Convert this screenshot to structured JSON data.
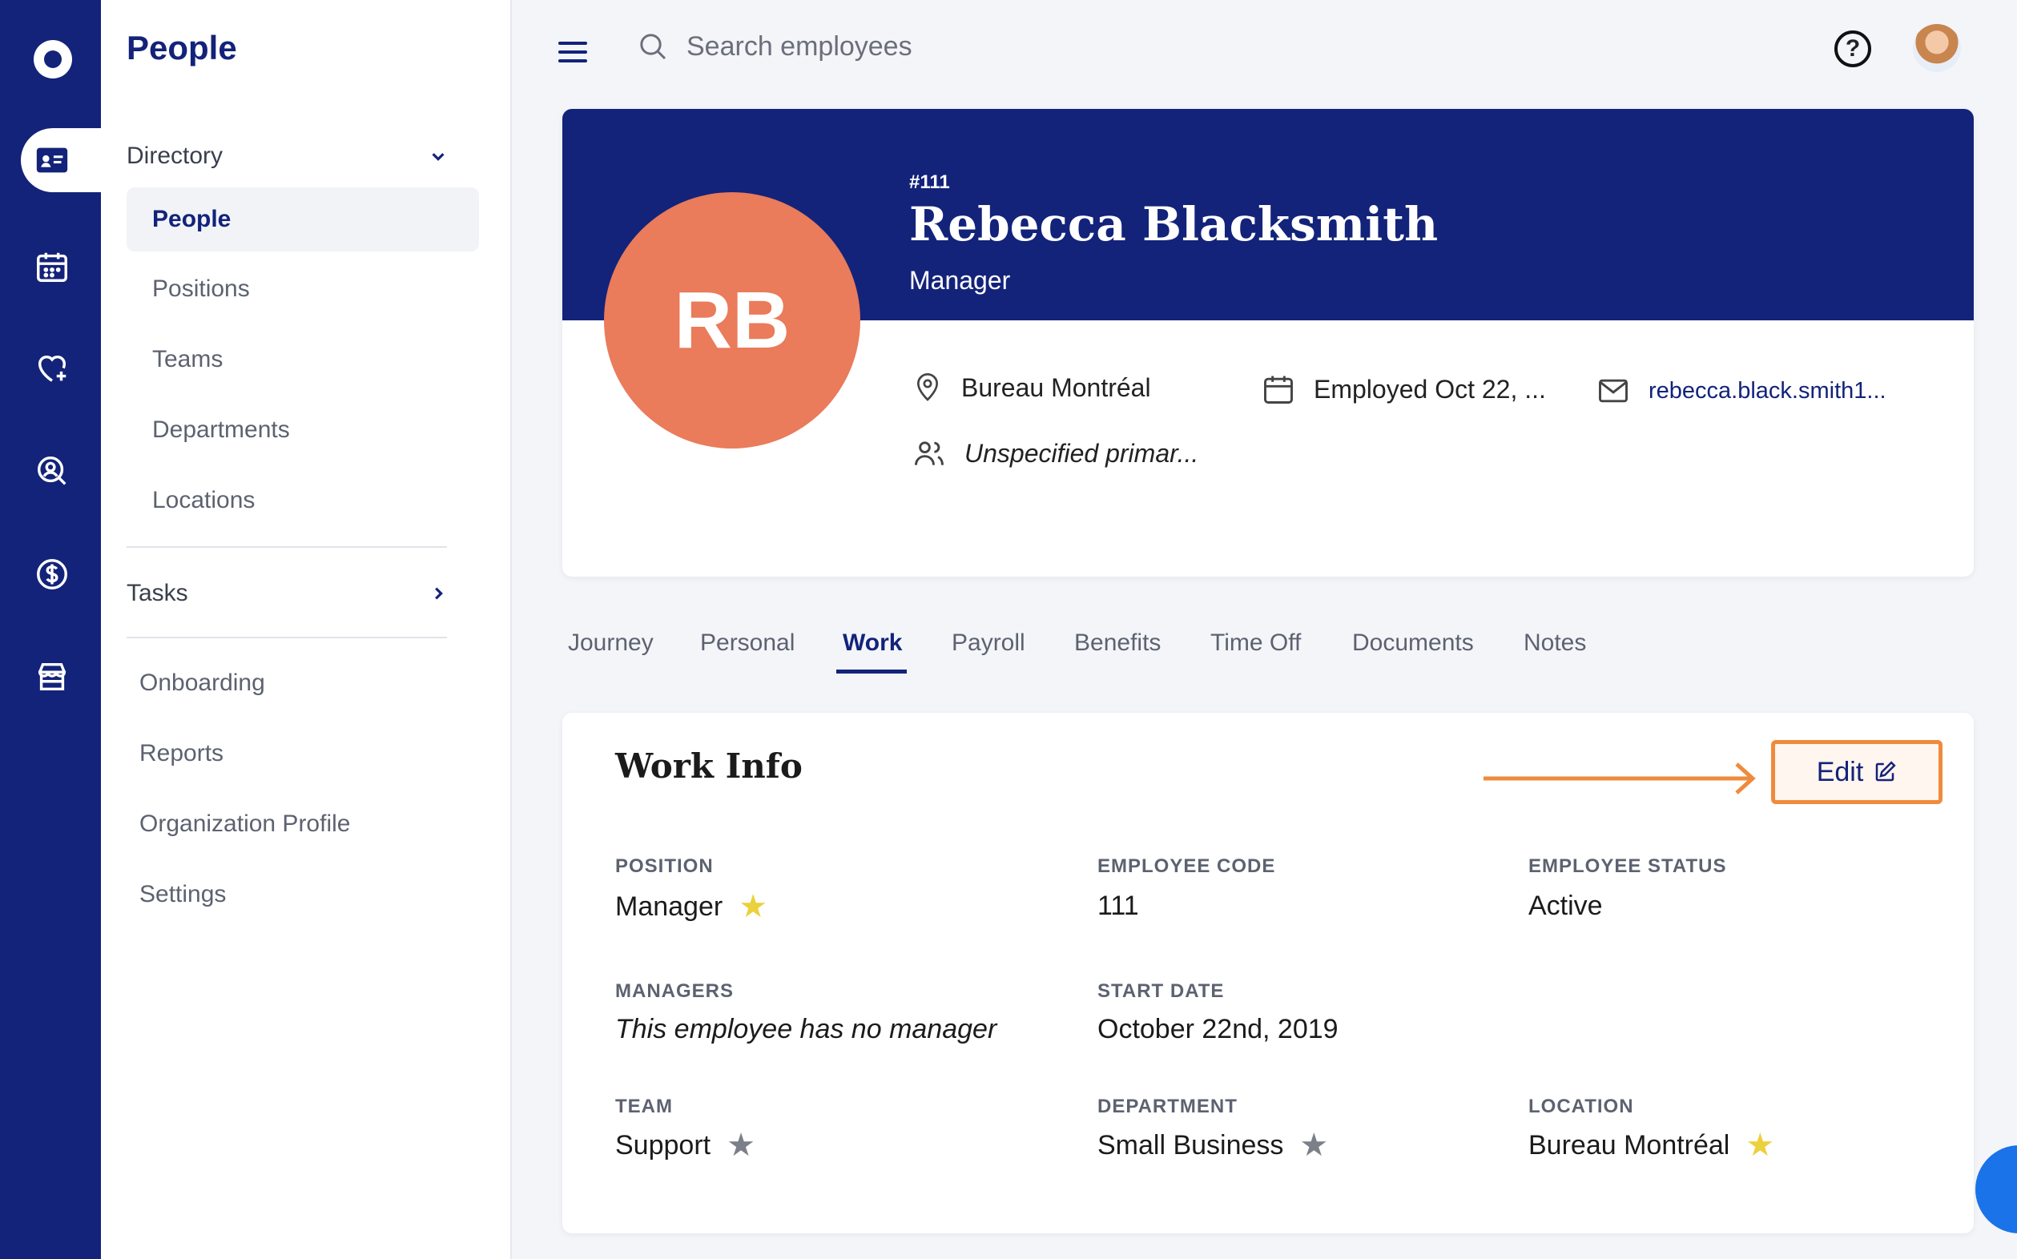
{
  "app": {
    "section_title": "People"
  },
  "rail": {
    "icons": [
      "logo-icon",
      "directory-icon",
      "calendar-icon",
      "heart-plus-icon",
      "people-search-icon",
      "dollar-icon",
      "store-icon"
    ]
  },
  "sidebar": {
    "directory": {
      "label": "Directory",
      "items": [
        "People",
        "Positions",
        "Teams",
        "Departments",
        "Locations"
      ],
      "active": "People"
    },
    "tasks": {
      "label": "Tasks"
    },
    "other_items": [
      "Onboarding",
      "Reports",
      "Organization Profile",
      "Settings"
    ]
  },
  "topbar": {
    "search_placeholder": "Search employees",
    "help_glyph": "?"
  },
  "profile": {
    "code": "#111",
    "name": "Rebecca Blacksmith",
    "title": "Manager",
    "initials": "RB",
    "location": "Bureau Montréal",
    "employed": "Employed Oct 22, ...",
    "email": "rebecca.black.smith1...",
    "team": "Unspecified primar...",
    "avatar_color": "#ea7b5b",
    "banner_color": "#13237a"
  },
  "tabs": [
    "Journey",
    "Personal",
    "Work",
    "Payroll",
    "Benefits",
    "Time Off",
    "Documents",
    "Notes"
  ],
  "active_tab": "Work",
  "work_info": {
    "title": "Work Info",
    "edit_label": "Edit",
    "fields": {
      "position": {
        "label": "POSITION",
        "value": "Manager",
        "star": "gold"
      },
      "employee_code": {
        "label": "EMPLOYEE CODE",
        "value": "111"
      },
      "employee_status": {
        "label": "EMPLOYEE STATUS",
        "value": "Active"
      },
      "managers": {
        "label": "MANAGERS",
        "value": "This employee has no manager"
      },
      "start_date": {
        "label": "START DATE",
        "value": "October 22nd, 2019"
      },
      "team": {
        "label": "TEAM",
        "value": "Support",
        "star": "grey"
      },
      "department": {
        "label": "DEPARTMENT",
        "value": "Small Business",
        "star": "grey"
      },
      "location": {
        "label": "LOCATION",
        "value": "Bureau Montréal",
        "star": "gold"
      }
    },
    "star_glyph": "★"
  },
  "colors": {
    "accent": "#13237a",
    "highlight": "#f08a3c"
  }
}
